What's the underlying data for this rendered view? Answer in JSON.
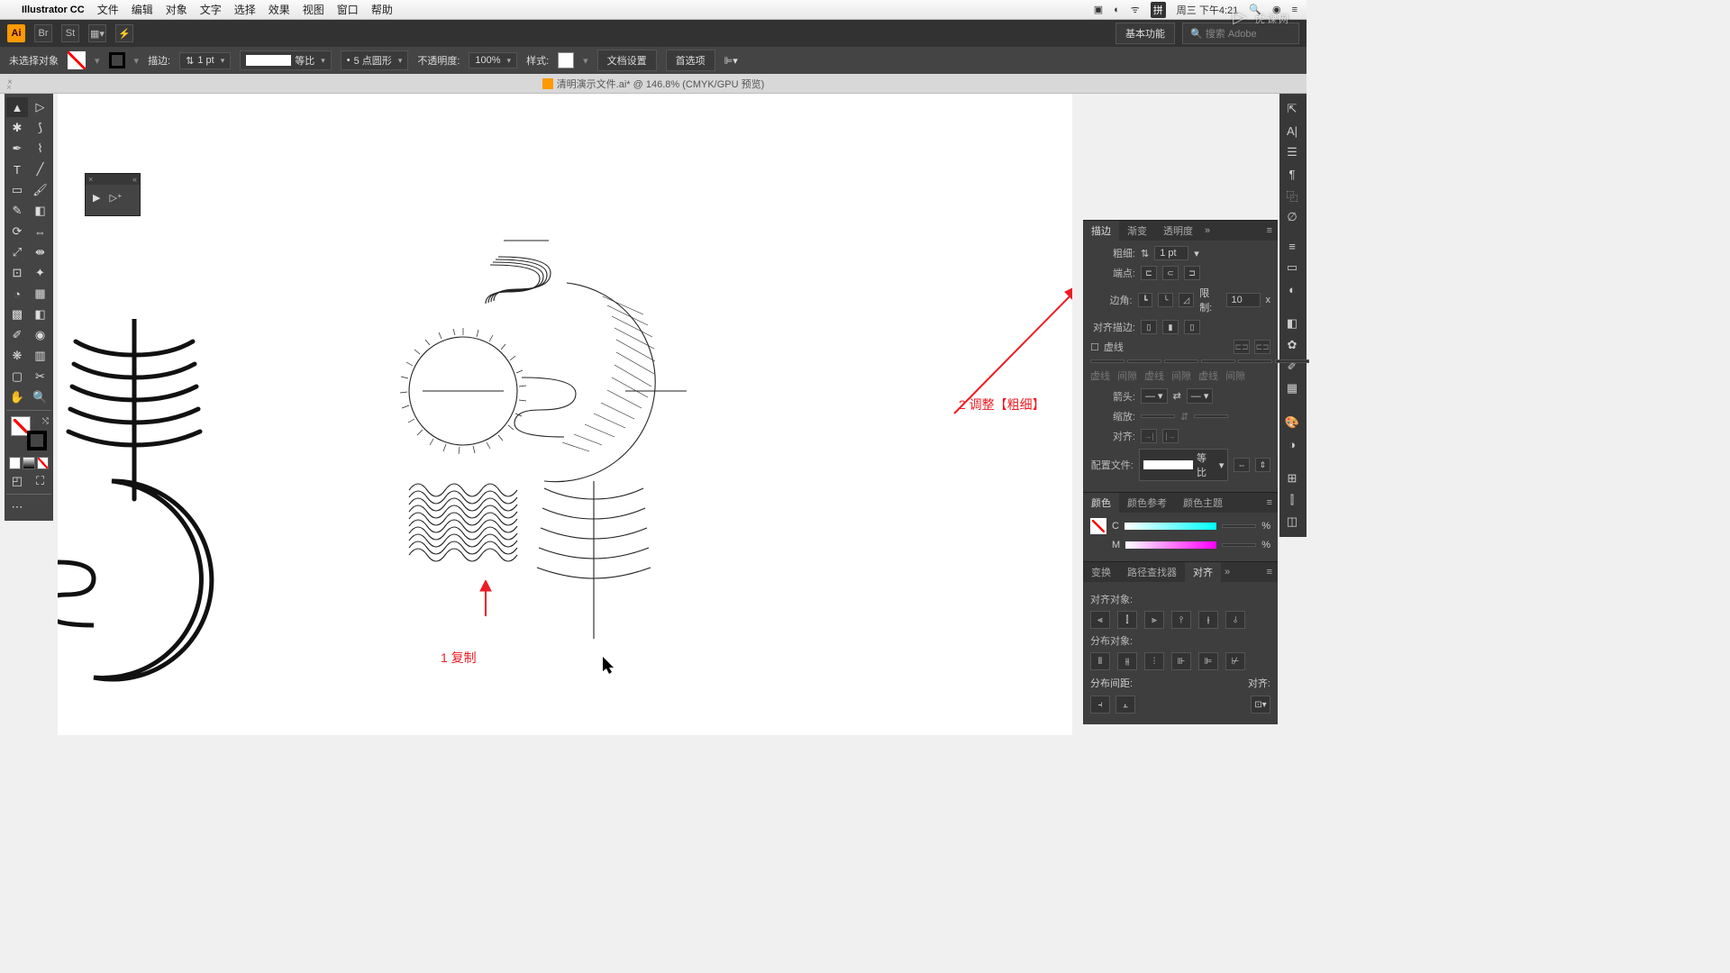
{
  "menubar": {
    "app": "Illustrator CC",
    "items": [
      "文件",
      "编辑",
      "对象",
      "文字",
      "选择",
      "效果",
      "视图",
      "窗口",
      "帮助"
    ],
    "right": {
      "ime": "拼",
      "day": "周三 下午4:21"
    }
  },
  "app_top": {
    "arrange": "基本功能",
    "search_placeholder": "搜索 Adobe"
  },
  "control": {
    "selection": "未选择对象",
    "stroke_label": "描边:",
    "stroke_weight": "1 pt",
    "profile": "等比",
    "brush": "5 点圆形",
    "opacity_label": "不透明度:",
    "opacity": "100%",
    "style_label": "样式:",
    "doc_setup": "文档设置",
    "prefs": "首选项"
  },
  "doc_tab": "清明演示文件.ai* @ 146.8% (CMYK/GPU 预览)",
  "annotations": {
    "a1": "1 复制",
    "a2": "2 调整【粗细】"
  },
  "stroke_panel": {
    "tabs": [
      "描边",
      "渐变",
      "透明度"
    ],
    "weight_label": "粗细:",
    "weight": "1 pt",
    "cap_label": "端点:",
    "corner_label": "边角:",
    "limit_label": "限制:",
    "limit": "10",
    "limit_unit": "x",
    "align_stroke_label": "对齐描边:",
    "dashed_label": "虚线",
    "dash_labels": [
      "虚线",
      "间隙",
      "虚线",
      "间隙",
      "虚线",
      "间隙"
    ],
    "arrow_label": "箭头:",
    "scale_label": "缩放:",
    "align_arrow_label": "对齐:",
    "profile_label": "配置文件:",
    "profile": "等比"
  },
  "color_panel": {
    "tabs": [
      "颜色",
      "颜色参考",
      "颜色主题"
    ],
    "c_label": "C",
    "m_label": "M",
    "pct": "%"
  },
  "align_panel": {
    "tabs": [
      "变换",
      "路径查找器",
      "对齐"
    ],
    "align_obj": "对齐对象:",
    "distribute": "分布对象:",
    "spacing": "分布间距:",
    "align_to": "对齐:"
  },
  "watermark": "虎课网"
}
